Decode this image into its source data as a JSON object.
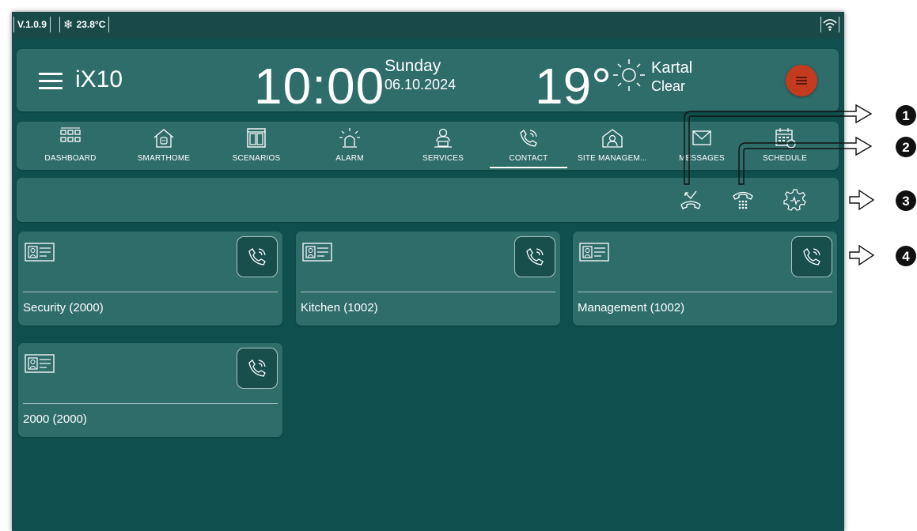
{
  "status": {
    "version": "V.1.0.9",
    "temperature": "23.8°C"
  },
  "header": {
    "app_name": "iX10",
    "time": "10:00",
    "day": "Sunday",
    "date": "06.10.2024",
    "temperature": "19°",
    "location": "Kartal",
    "condition": "Clear"
  },
  "nav": {
    "items": [
      {
        "label": "DASHBOARD",
        "icon": "dashboard-icon"
      },
      {
        "label": "SMARTHOME",
        "icon": "smarthome-icon"
      },
      {
        "label": "SCENARIOS",
        "icon": "scenarios-icon"
      },
      {
        "label": "ALARM",
        "icon": "alarm-icon"
      },
      {
        "label": "SERVICES",
        "icon": "services-icon"
      },
      {
        "label": "CONTACT",
        "icon": "contact-icon"
      },
      {
        "label": "SITE MANAGEM...",
        "icon": "site-management-icon"
      },
      {
        "label": "MESSAGES",
        "icon": "messages-icon"
      },
      {
        "label": "SCHEDULE",
        "icon": "schedule-icon"
      }
    ],
    "active": "CONTACT"
  },
  "toolbar": {
    "icons": [
      "missed-call-icon",
      "phone-keypad-icon",
      "settings-gear-icon"
    ]
  },
  "contacts": [
    {
      "name": "Security (2000)"
    },
    {
      "name": "Kitchen (1002)"
    },
    {
      "name": "Management (1002)"
    },
    {
      "name": "2000 (2000)"
    }
  ],
  "callouts": [
    "1",
    "2",
    "3",
    "4"
  ],
  "colors": {
    "background": "#0f4f4e",
    "panel": "#2f6d6b",
    "accent": "#c43a1e",
    "statusbar": "#1a4a48"
  }
}
